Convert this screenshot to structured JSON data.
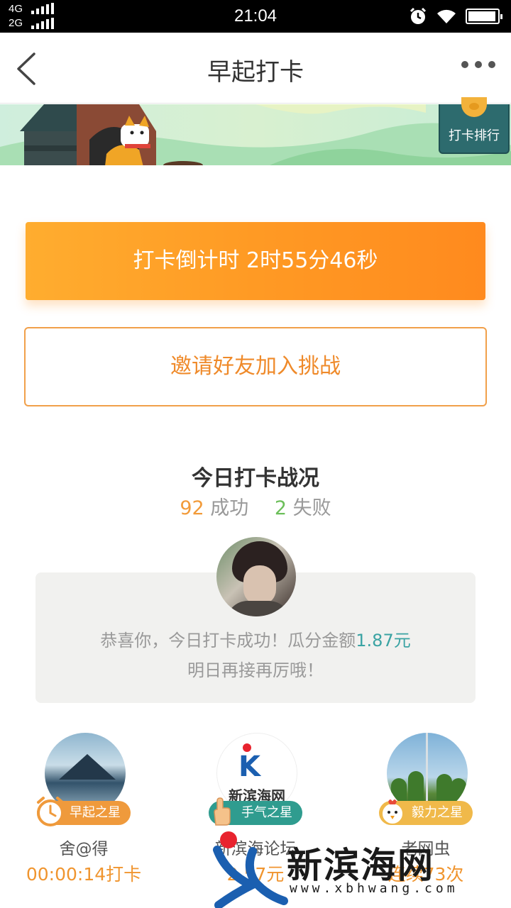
{
  "status_bar": {
    "network_1": "4G",
    "network_2": "2G",
    "time": "21:04",
    "battery_level": 0.95
  },
  "nav": {
    "title": "早起打卡"
  },
  "banner": {
    "rank_label": "打卡排行"
  },
  "countdown": {
    "label": "打卡倒计时  2时55分46秒"
  },
  "invite": {
    "label": "邀请好友加入挑战"
  },
  "stats": {
    "title": "今日打卡战况",
    "success_count": "92",
    "success_label": "成功",
    "fail_count": "2",
    "fail_label": "失败"
  },
  "message": {
    "line1_prefix": "恭喜你，今日打卡成功！瓜分金额",
    "amount": "1.87元",
    "line2": "明日再接再厉哦！"
  },
  "stars": [
    {
      "badge": "早起之星",
      "name": "舍@得",
      "stat": "00:00:14打卡"
    },
    {
      "badge": "手气之星",
      "name": "新滨海论坛",
      "stat": "2.57元",
      "avatar_text": "新滨海网"
    },
    {
      "badge": "毅力之星",
      "name": "老网虫",
      "stat": "连续73次"
    }
  ],
  "watermark": {
    "text": "新滨海网",
    "url": "www.xbhwang.com"
  },
  "colors": {
    "accent_orange": "#ff9a24",
    "success": "#f29b3a",
    "fail": "#6cbf5a",
    "teal": "#2f9c8f"
  }
}
